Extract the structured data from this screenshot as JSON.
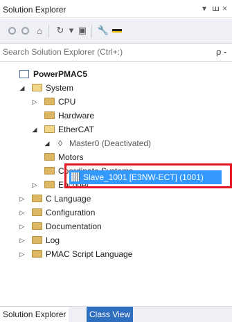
{
  "window": {
    "title": "Solution Explorer",
    "pin_glyph": "▾ ꟺ",
    "close_glyph": "×"
  },
  "toolbar": {
    "buttons": [
      "back-icon",
      "forward-icon",
      "home-icon",
      "history-icon",
      "collapse-icon",
      "properties-icon",
      "pin-icon"
    ]
  },
  "search": {
    "placeholder": "Search Solution Explorer (Ctrl+:)",
    "value": "",
    "icon_glyph": "ρ -"
  },
  "tree": {
    "project": "PowerPMAC5",
    "system": "System",
    "cpu": "CPU",
    "hardware": "Hardware",
    "ethercat": "EtherCAT",
    "master": "Master0 (Deactivated)",
    "slave": "Slave_1001 [E3NW-ECT] (1001)",
    "motors": "Motors",
    "coordinate_systems": "Coordinate Systems",
    "encoder": "Encoder",
    "c_language": "C Language",
    "configuration": "Configuration",
    "documentation": "Documentation",
    "log": "Log",
    "pmac_script": "PMAC Script Language"
  },
  "tabs": {
    "active": "Solution Explorer",
    "inactive": "Class View"
  },
  "colors": {
    "selection": "#3399ff",
    "highlight_box": "#e3131f",
    "folder": "#dcb864"
  }
}
